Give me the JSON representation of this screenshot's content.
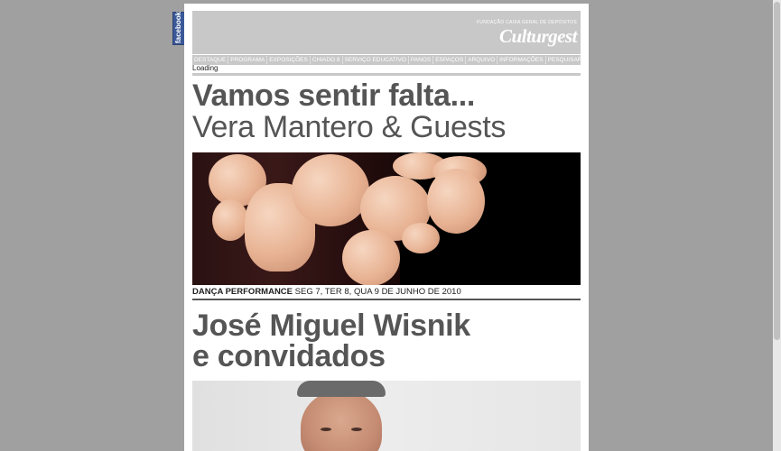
{
  "facebook_tab": {
    "label": "facebook"
  },
  "header": {
    "foundation": "FUNDAÇÃO CAIXA GERAL DE DEPÓSITOS",
    "brand": "Culturgest"
  },
  "nav": {
    "items": [
      "DESTAQUE",
      "PROGRAMA",
      "EXPOSIÇÕES",
      "CHIADO 8",
      "SERVIÇO EDUCATIVO",
      "PANOS",
      "ESPAÇOS",
      "ARQUIVO",
      "INFORMAÇÕES",
      "PESQUISAR"
    ]
  },
  "status": {
    "loading": "Loading"
  },
  "event1": {
    "title": "Vamos sentir falta...",
    "subtitle": "Vera Mantero & Guests",
    "category": "DANÇA PERFORMANCE",
    "dates": "SEG 7, TER 8, QUA 9 DE JUNHO DE 2010"
  },
  "event2": {
    "title_line1": "José Miguel Wisnik",
    "title_line2": "e convidados"
  }
}
